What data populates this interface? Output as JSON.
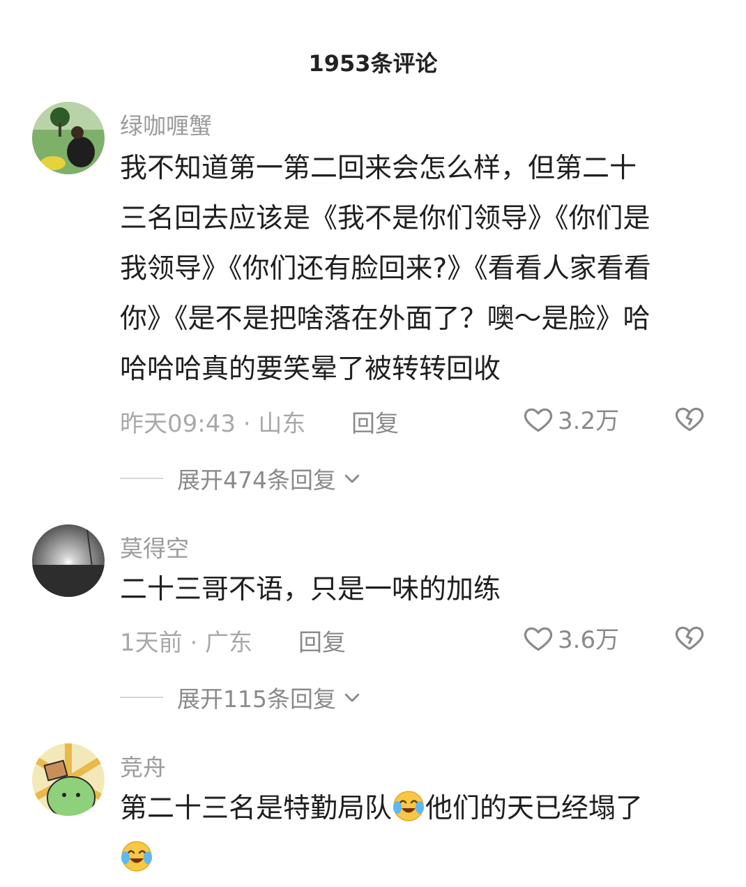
{
  "header": {
    "title": "1953条评论"
  },
  "comments": [
    {
      "username": "绿咖喱蟹",
      "lines": [
        "我不知道第一第二回来会怎么样，但第二十",
        "三名回去应该是《我不是你们领导》《你们是",
        "我领导》《你们还有脸回来?》《看看人家看看",
        "你》《是不是把啥落在外面了？噢～是脸》哈",
        "哈哈哈真的要笑晕了被转转回收"
      ],
      "time_location": "昨天09:43 · 山东",
      "reply_label": "回复",
      "likes": "3.2万",
      "expand_label": "展开474条回复"
    },
    {
      "username": "莫得空",
      "lines": [
        "二十三哥不语，只是一味的加练"
      ],
      "time_location": "1天前 · 广东",
      "reply_label": "回复",
      "likes": "3.6万",
      "expand_label": "展开115条回复"
    },
    {
      "username": "竞舟",
      "text_before_emoji": "第二十三名是特勤局队",
      "text_after_emoji": "他们的天已经塌了",
      "emoji": "crying-laughing-emoji"
    }
  ],
  "colors": {
    "username": "#9b9b9b",
    "meta": "#a8a8a8",
    "text": "#1f1f1f",
    "emoji": "#f7c846"
  }
}
